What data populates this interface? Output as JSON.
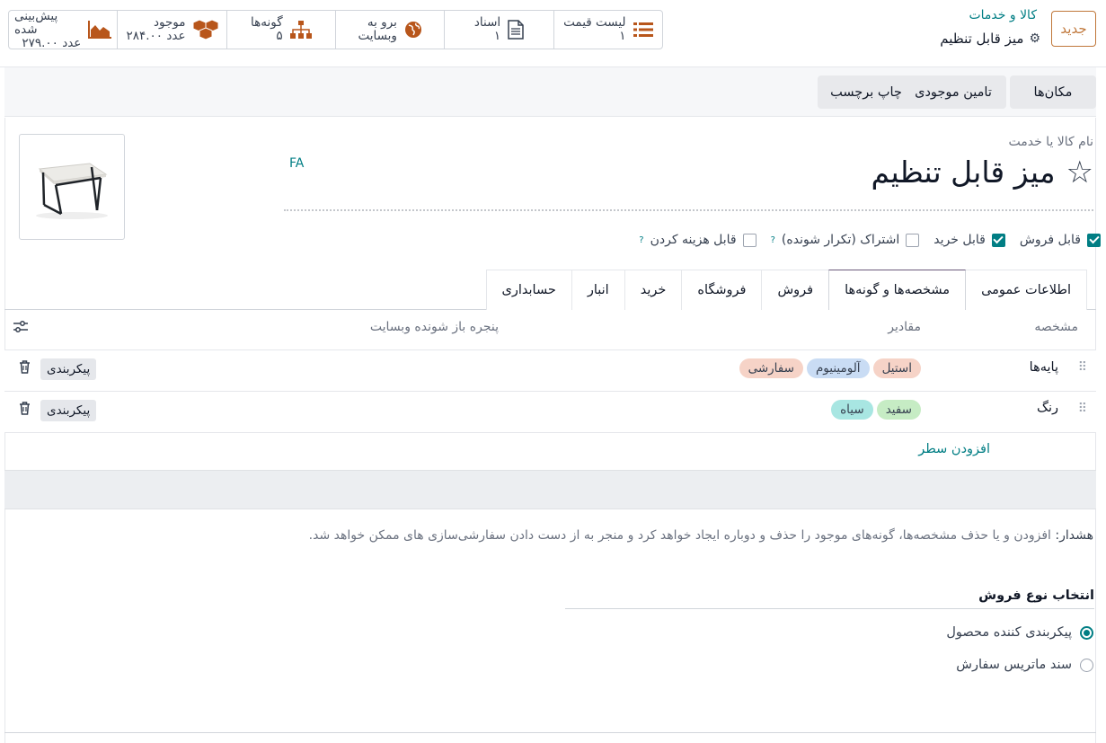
{
  "header": {
    "new_label": "جدید",
    "breadcrumb_parent": "کالا و خدمات",
    "breadcrumb_current": "میز قابل تنظیم"
  },
  "stats": [
    {
      "icon": "list-icon",
      "label": "لیست قیمت",
      "value": "۱"
    },
    {
      "icon": "document-icon",
      "label": "اسناد",
      "value": "۱"
    },
    {
      "icon": "globe-icon",
      "label": "برو به",
      "value": "وبسایت"
    },
    {
      "icon": "sitemap-icon",
      "label": "گونه‌ها",
      "value": "۵"
    },
    {
      "icon": "cubes-icon",
      "label": "موجود",
      "value": "۲۸۴.۰۰ عدد"
    },
    {
      "icon": "area-chart-icon",
      "label": "پیش‌بینی شده",
      "value": "۲۷۹.۰۰ عدد"
    }
  ],
  "actions": {
    "locations": "مکان‌ها",
    "replenish": "تامین موجودی",
    "print_labels": "چاپ برچسب"
  },
  "product": {
    "name_label": "نام کالا یا خدمت",
    "name": "میز قابل تنظیم",
    "lang": "FA"
  },
  "flags": [
    {
      "label": "قابل فروش",
      "checked": true,
      "help": ""
    },
    {
      "label": "قابل خرید",
      "checked": true,
      "help": ""
    },
    {
      "label": "اشتراک (تکرار شونده)",
      "checked": false,
      "help": "?"
    },
    {
      "label": "قابل هزینه کردن",
      "checked": false,
      "help": "?"
    }
  ],
  "tabs": [
    "اطلاعات عمومی",
    "مشخصه‌ها و گونه‌ها",
    "فروش",
    "فروشگاه",
    "خرید",
    "انبار",
    "حسابداری"
  ],
  "active_tab": 1,
  "table": {
    "col_attribute": "مشخصه",
    "col_values": "مقادیر",
    "col_website": "پنجره باز شونده وبسایت",
    "rows": [
      {
        "attribute": "پایه‌ها",
        "values": [
          {
            "text": "استیل",
            "color": "#f6d3c7"
          },
          {
            "text": "آلومینیوم",
            "color": "#c9dcf4"
          },
          {
            "text": "سفارشی",
            "color": "#f6d3c7"
          }
        ],
        "config": "پیکربندی"
      },
      {
        "attribute": "رنگ",
        "values": [
          {
            "text": "سفید",
            "color": "#c6ecc4"
          },
          {
            "text": "سیاه",
            "color": "#a8e6e2"
          }
        ],
        "config": "پیکربندی"
      }
    ],
    "add_line": "افزودن سطر"
  },
  "warning": {
    "strong": "هشدار:",
    "text": " افزودن و یا حذف مشخصه‌ها، گونه‌های موجود را حذف و دوباره ایجاد خواهد کرد و منجر به از دست دادن سفارشی‌سازی های ممکن خواهد شد."
  },
  "sales_type": {
    "title": "انتخاب نوع فروش",
    "options": [
      {
        "label": "پیکربندی کننده محصول",
        "selected": true
      },
      {
        "label": "سند ماتریس سفارش",
        "selected": false
      }
    ]
  },
  "colors": {
    "accent": "#017e84",
    "brand": "#c0773a"
  }
}
